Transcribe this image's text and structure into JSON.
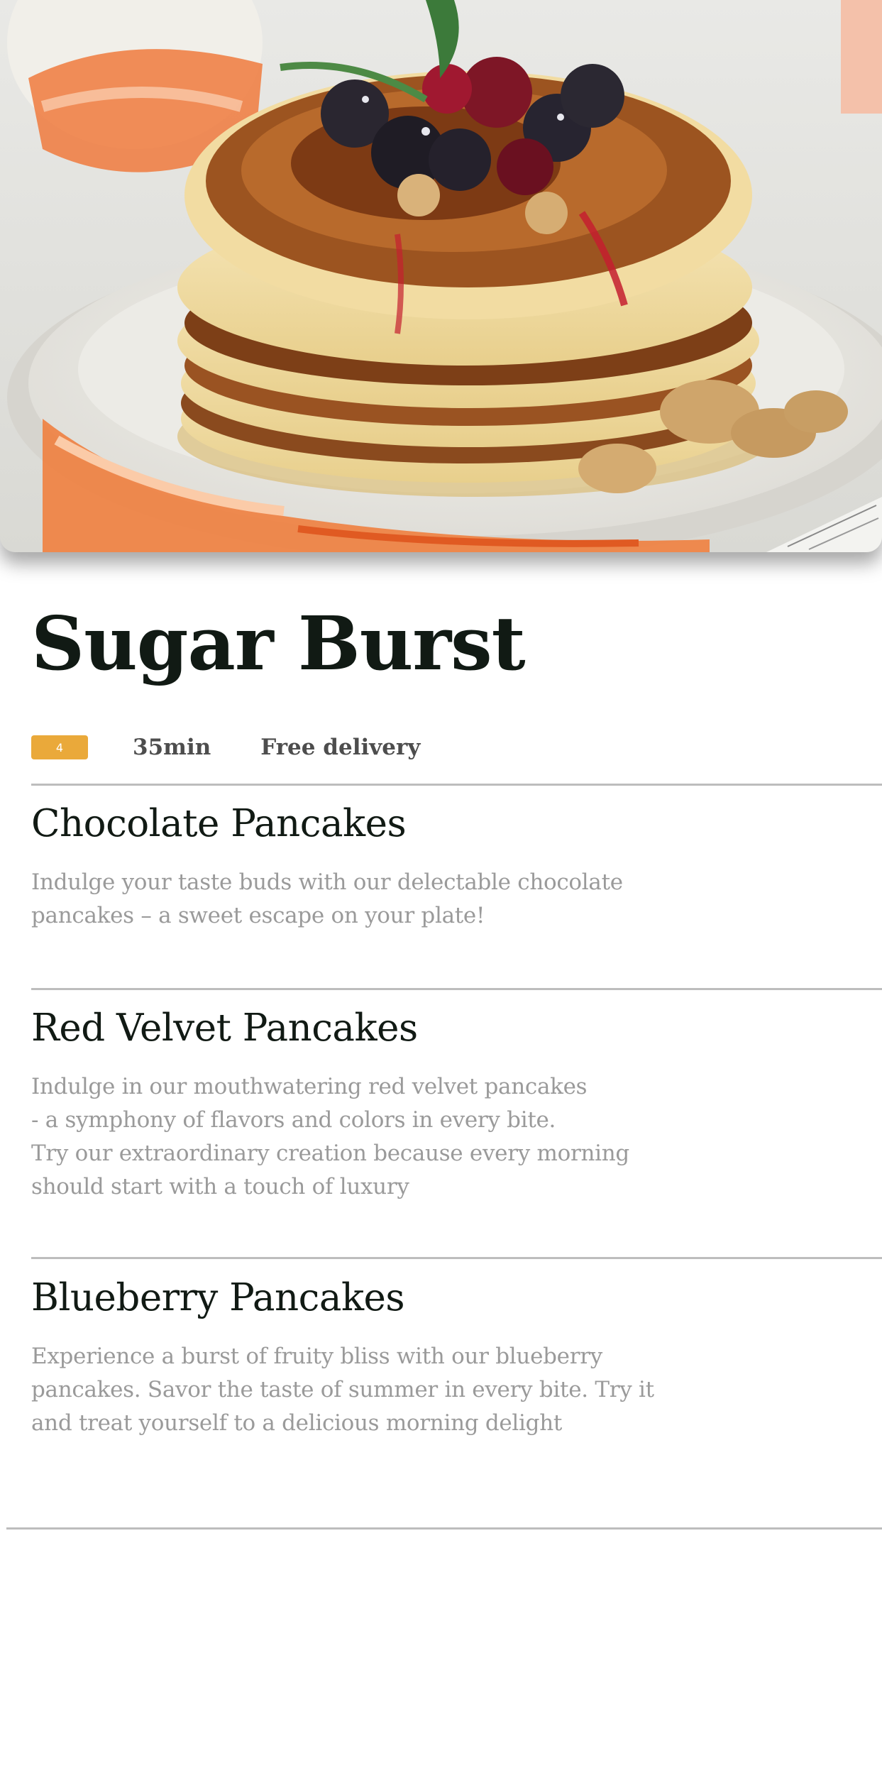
{
  "restaurant": {
    "name": "Sugar Burst",
    "rating": "4",
    "delivery_time": "35min",
    "delivery_fee": "Free delivery"
  },
  "menu": [
    {
      "name": "Chocolate Pancakes",
      "description": "Indulge your taste buds with our delectable chocolate\npancakes – a sweet escape on your plate!"
    },
    {
      "name": "Red Velvet Pancakes",
      "description": "Indulge in our mouthwatering red velvet pancakes\n - a symphony of flavors and colors in every bite.\n Try our extraordinary creation because every morning\n should start with a touch of luxury"
    },
    {
      "name": "Blueberry Pancakes",
      "description": "Experience a burst of fruity bliss with our blueberry\npancakes. Savor the taste of summer in every bite. Try it\nand treat yourself to a delicious morning delight"
    }
  ],
  "colors": {
    "rating_badge": "#eaa93a",
    "title": "#111a14",
    "description": "#9a9a9a",
    "divider": "#bdbdbd"
  }
}
